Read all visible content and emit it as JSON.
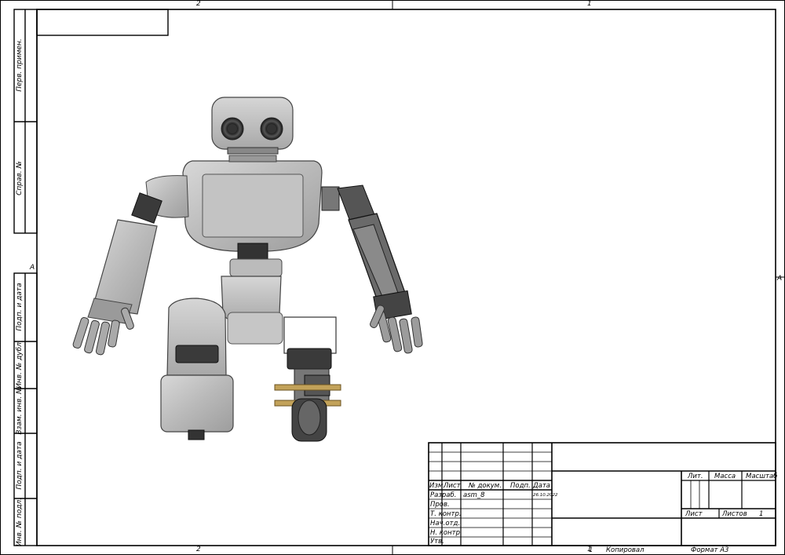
{
  "zones": {
    "top_left": "2",
    "top_right": "1",
    "bottom_left": "2",
    "bottom_right": "1",
    "left_mid": "A",
    "right_mid": "A"
  },
  "side_strip": {
    "perv_primen": "Перв. примен.",
    "sprav_no": "Справ. №",
    "podp_data_1": "Подп. и дата",
    "inv_dubl": "Инв. № дубл.",
    "vzam_inv": "Взам. инв. №",
    "podp_data_2": "Подп. и дата",
    "inv_podl": "Инв. № подл."
  },
  "title_block": {
    "headers": {
      "izm": "Изм.",
      "list": "Лист",
      "doc_no": "№ докум.",
      "podp": "Подп.",
      "data": "Дата"
    },
    "rows": {
      "razrab": "Разраб.",
      "prov": "Пров.",
      "t_kontr": "Т. контр.",
      "nach_otd": "Нач.отд.",
      "n_kontr": "Н. контр.",
      "utv": "Утв."
    },
    "razrab_doc": "asm_8",
    "razrab_date": "26.10.2022",
    "lit": "Лит.",
    "massa": "Масса",
    "masshtab": "Масштаб",
    "list_label": "Лист",
    "listov_label": "Листов",
    "listov_value": "1"
  },
  "footer": {
    "copy_number": "1",
    "kopiroval": "Копировал",
    "format": "Формат А3"
  }
}
